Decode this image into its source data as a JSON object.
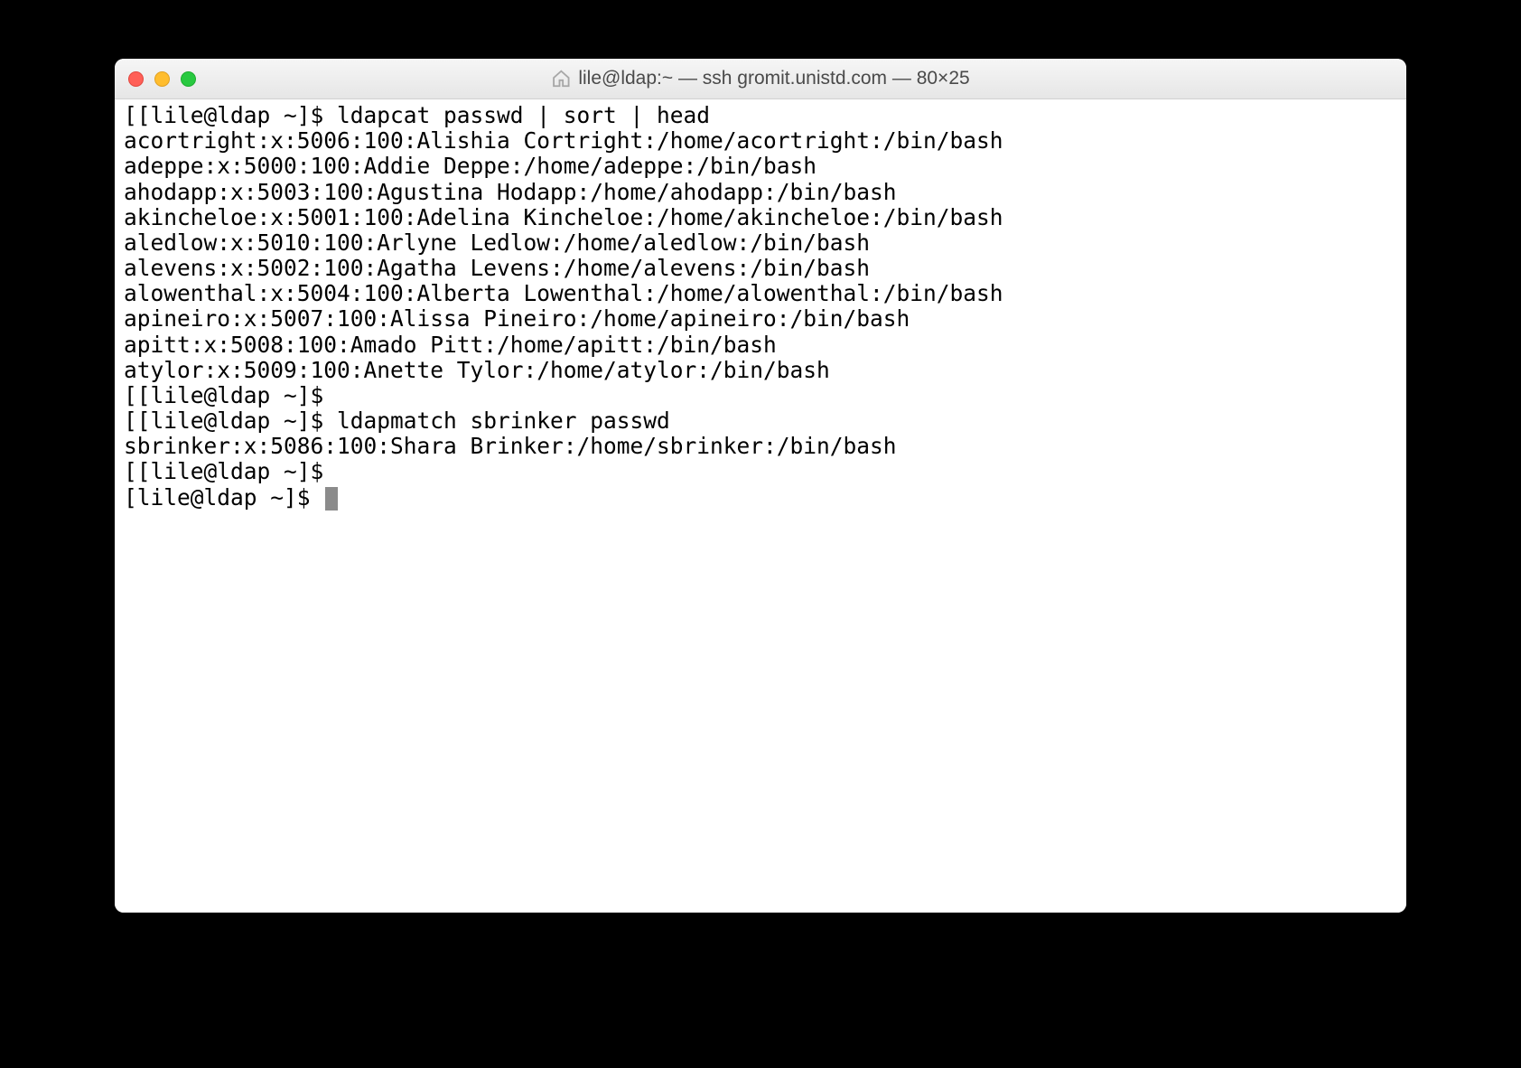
{
  "window": {
    "title": "lile@ldap:~ — ssh gromit.unistd.com — 80×25"
  },
  "terminal": {
    "lines": [
      {
        "prefix": "[",
        "text": "[lile@ldap ~]$ ldapcat passwd | sort | head"
      },
      {
        "prefix": "",
        "text": "acortright:x:5006:100:Alishia Cortright:/home/acortright:/bin/bash"
      },
      {
        "prefix": "",
        "text": "adeppe:x:5000:100:Addie Deppe:/home/adeppe:/bin/bash"
      },
      {
        "prefix": "",
        "text": "ahodapp:x:5003:100:Agustina Hodapp:/home/ahodapp:/bin/bash"
      },
      {
        "prefix": "",
        "text": "akincheloe:x:5001:100:Adelina Kincheloe:/home/akincheloe:/bin/bash"
      },
      {
        "prefix": "",
        "text": "aledlow:x:5010:100:Arlyne Ledlow:/home/aledlow:/bin/bash"
      },
      {
        "prefix": "",
        "text": "alevens:x:5002:100:Agatha Levens:/home/alevens:/bin/bash"
      },
      {
        "prefix": "",
        "text": "alowenthal:x:5004:100:Alberta Lowenthal:/home/alowenthal:/bin/bash"
      },
      {
        "prefix": "",
        "text": "apineiro:x:5007:100:Alissa Pineiro:/home/apineiro:/bin/bash"
      },
      {
        "prefix": "",
        "text": "apitt:x:5008:100:Amado Pitt:/home/apitt:/bin/bash"
      },
      {
        "prefix": "",
        "text": "atylor:x:5009:100:Anette Tylor:/home/atylor:/bin/bash"
      },
      {
        "prefix": "[",
        "text": "[lile@ldap ~]$ "
      },
      {
        "prefix": "[",
        "text": "[lile@ldap ~]$ ldapmatch sbrinker passwd"
      },
      {
        "prefix": "",
        "text": "sbrinker:x:5086:100:Shara Brinker:/home/sbrinker:/bin/bash"
      },
      {
        "prefix": "[",
        "text": "[lile@ldap ~]$ "
      }
    ],
    "final_prompt": "[lile@ldap ~]$ "
  }
}
